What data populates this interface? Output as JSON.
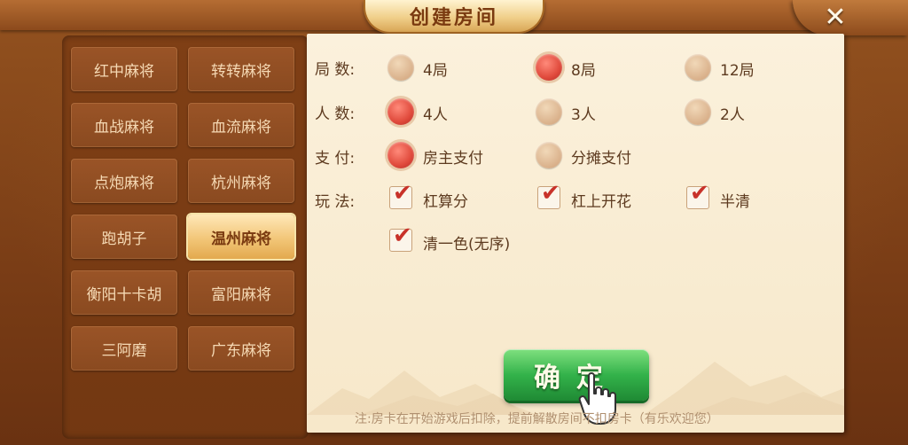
{
  "window": {
    "title": "创建房间",
    "close_symbol": "✕"
  },
  "games": [
    {
      "label": "红中麻将",
      "active": false
    },
    {
      "label": "转转麻将",
      "active": false
    },
    {
      "label": "血战麻将",
      "active": false
    },
    {
      "label": "血流麻将",
      "active": false
    },
    {
      "label": "点炮麻将",
      "active": false
    },
    {
      "label": "杭州麻将",
      "active": false
    },
    {
      "label": "跑胡子",
      "active": false
    },
    {
      "label": "温州麻将",
      "active": true
    },
    {
      "label": "衡阳十卡胡",
      "active": false
    },
    {
      "label": "富阳麻将",
      "active": false
    },
    {
      "label": "三阿磨",
      "active": false
    },
    {
      "label": "广东麻将",
      "active": false
    }
  ],
  "settings": {
    "rounds": {
      "label": "局 数:",
      "options": [
        {
          "label": "4局",
          "selected": false
        },
        {
          "label": "8局",
          "selected": true
        },
        {
          "label": "12局",
          "selected": false
        }
      ]
    },
    "players": {
      "label": "人 数:",
      "options": [
        {
          "label": "4人",
          "selected": true
        },
        {
          "label": "3人",
          "selected": false
        },
        {
          "label": "2人",
          "selected": false
        }
      ]
    },
    "payment": {
      "label": "支 付:",
      "options": [
        {
          "label": "房主支付",
          "selected": true
        },
        {
          "label": "分摊支付",
          "selected": false
        }
      ]
    },
    "play": {
      "label": "玩 法:",
      "options": [
        {
          "label": "杠算分",
          "checked": true
        },
        {
          "label": "杠上开花",
          "checked": true
        },
        {
          "label": "半清",
          "checked": true
        },
        {
          "label": "清一色(无序)",
          "checked": true
        }
      ]
    }
  },
  "confirm_label": "确定",
  "note": "注:房卡在开始游戏后扣除，提前解散房间不扣房卡（有乐欢迎您）",
  "colors": {
    "radio_selected": "#e04a3c",
    "confirm_green": "#33b24a",
    "active_tab": "#f2c678"
  }
}
